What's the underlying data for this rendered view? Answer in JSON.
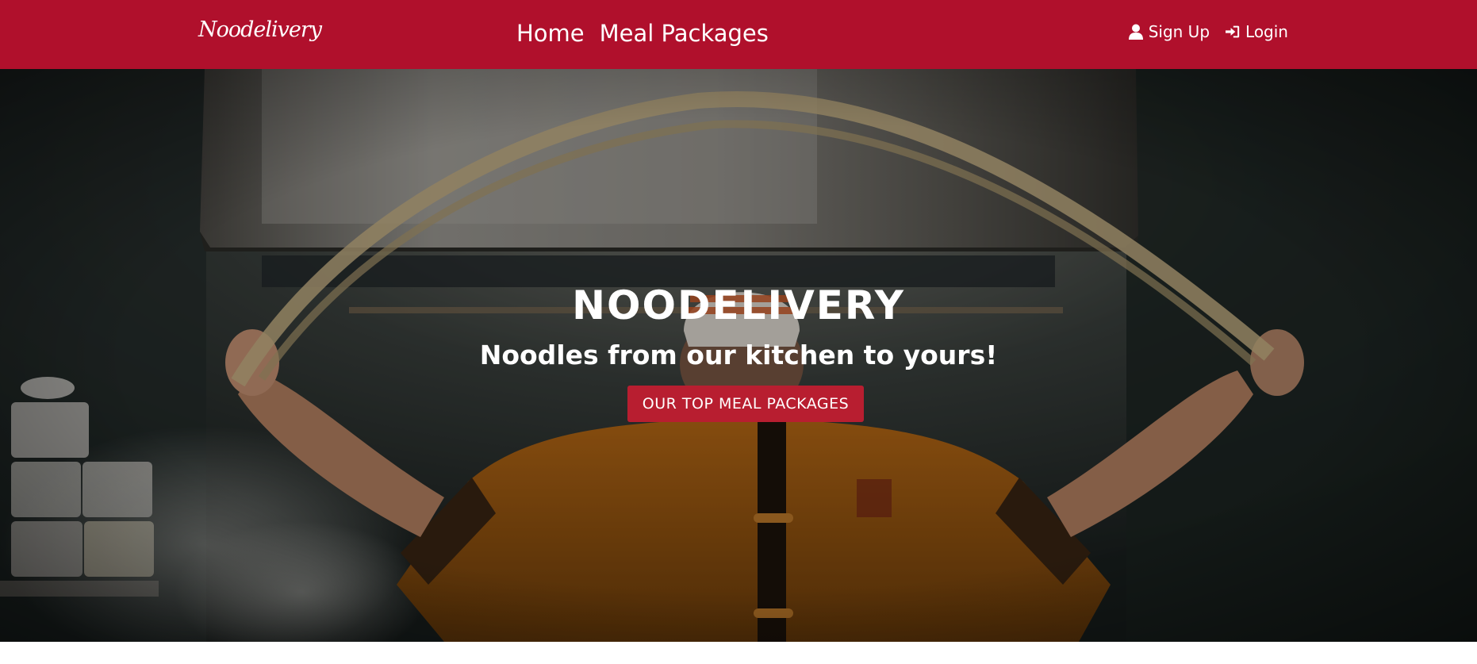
{
  "navbar": {
    "brand": "Noodelivery",
    "links": [
      {
        "label": "Home"
      },
      {
        "label": "Meal Packages"
      }
    ],
    "auth": {
      "signup_label": "Sign Up",
      "signup_icon": "user-icon",
      "login_label": "Login",
      "login_icon": "sign-in-icon"
    }
  },
  "hero": {
    "title": "NOODELIVERY",
    "subtitle": "Noodles from our kitchen to yours!",
    "cta_label": "OUR TOP MEAL PACKAGES"
  },
  "colors": {
    "brand_red": "#b0102c",
    "button_red": "#b81e30",
    "text_white": "#ffffff"
  }
}
